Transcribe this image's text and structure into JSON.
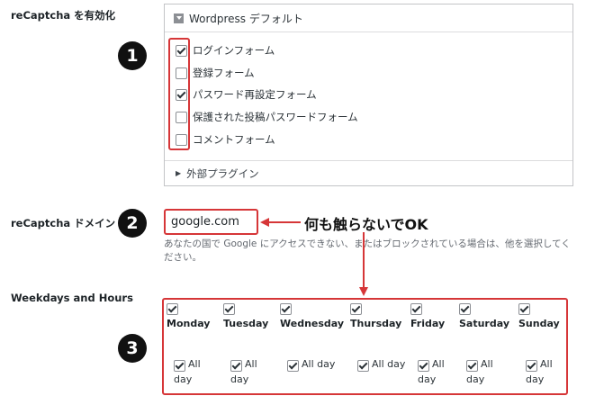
{
  "labels": {
    "recaptcha_enable": "reCaptcha を有効化",
    "recaptcha_domain": "reCaptcha ドメイン",
    "weekdays_hours": "Weekdays and Hours"
  },
  "panel": {
    "header": "Wordpress デフォルト",
    "options": [
      {
        "label": "ログインフォーム",
        "checked": true
      },
      {
        "label": "登録フォーム",
        "checked": false
      },
      {
        "label": "パスワード再設定フォーム",
        "checked": true
      },
      {
        "label": "保護された投稿パスワードフォーム",
        "checked": false
      },
      {
        "label": "コメントフォーム",
        "checked": false
      }
    ],
    "footer": "外部プラグイン"
  },
  "domain": {
    "value": "google.com",
    "help": "あなたの国で Google にアクセスできない、またはブロックされている場合は、他を選択してください。"
  },
  "annotation": "何も触らないでOK",
  "markers": [
    "1",
    "2",
    "3"
  ],
  "weekdays": [
    {
      "name": "Monday",
      "checked": true,
      "all": "All",
      "day": "day",
      "all_day_checked": true
    },
    {
      "name": "Tuesday",
      "checked": true,
      "all": "All",
      "day": "day",
      "all_day_checked": true
    },
    {
      "name": "Wednesday",
      "checked": true,
      "all": "All day",
      "day": "",
      "all_day_checked": true
    },
    {
      "name": "Thursday",
      "checked": true,
      "all": "All day",
      "day": "",
      "all_day_checked": true
    },
    {
      "name": "Friday",
      "checked": true,
      "all": "All",
      "day": "day",
      "all_day_checked": true
    },
    {
      "name": "Saturday",
      "checked": true,
      "all": "All",
      "day": "day",
      "all_day_checked": true
    },
    {
      "name": "Sunday",
      "checked": true,
      "all": "All",
      "day": "day",
      "all_day_checked": true
    }
  ],
  "colors": {
    "highlight": "#d63638",
    "marker": "#111111"
  }
}
